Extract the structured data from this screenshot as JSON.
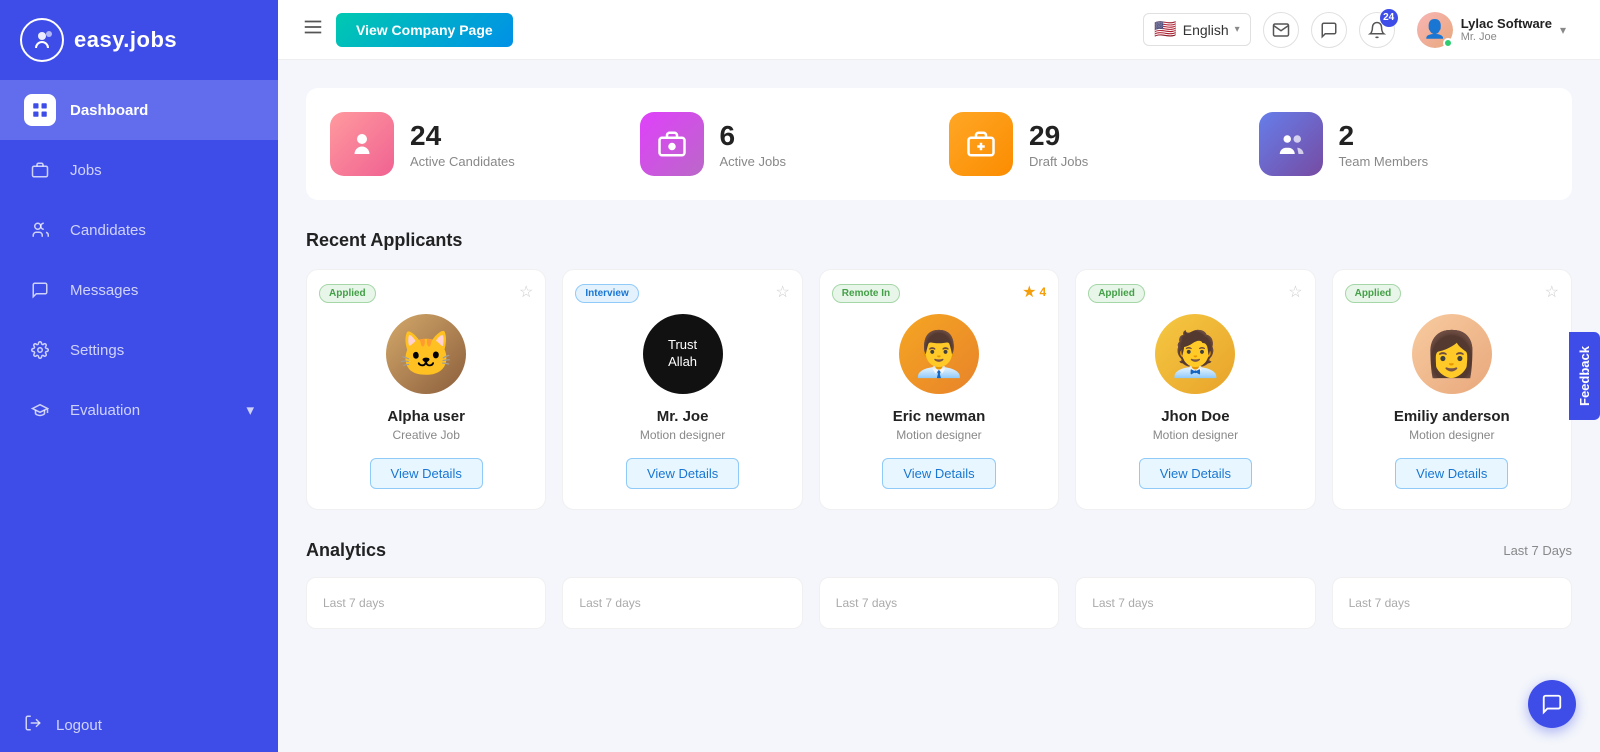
{
  "brand": {
    "logo_text": "easy.jobs",
    "logo_symbol": "i"
  },
  "sidebar": {
    "items": [
      {
        "id": "dashboard",
        "label": "Dashboard",
        "active": true
      },
      {
        "id": "jobs",
        "label": "Jobs",
        "active": false
      },
      {
        "id": "candidates",
        "label": "Candidates",
        "active": false
      },
      {
        "id": "messages",
        "label": "Messages",
        "active": false
      },
      {
        "id": "settings",
        "label": "Settings",
        "active": false
      },
      {
        "id": "evaluation",
        "label": "Evaluation",
        "active": false,
        "has_chevron": true
      }
    ],
    "logout_label": "Logout"
  },
  "header": {
    "view_company_btn": "View Company Page",
    "language": "English",
    "notification_count": "24",
    "user": {
      "company": "Lylac Software",
      "name": "Mr. Joe"
    }
  },
  "stats": [
    {
      "id": "active-candidates",
      "number": "24",
      "label": "Active Candidates",
      "icon_type": "person",
      "color": "pink"
    },
    {
      "id": "active-jobs",
      "number": "6",
      "label": "Active Jobs",
      "icon_type": "briefcase",
      "color": "magenta"
    },
    {
      "id": "draft-jobs",
      "number": "29",
      "label": "Draft Jobs",
      "icon_type": "briefcase",
      "color": "orange"
    },
    {
      "id": "team-members",
      "number": "2",
      "label": "Team Members",
      "icon_type": "group",
      "color": "blue-purple"
    }
  ],
  "recent_applicants": {
    "title": "Recent Applicants",
    "cards": [
      {
        "id": "alpha-user",
        "badge": "Applied",
        "badge_type": "applied",
        "name": "Alpha user",
        "role": "Creative Job",
        "has_star": true,
        "avatar_type": "cat",
        "view_label": "View Details"
      },
      {
        "id": "mr-joe",
        "badge": "Interview",
        "badge_type": "interview",
        "name": "Mr. Joe",
        "role": "Motion designer",
        "has_star": true,
        "avatar_type": "allah",
        "view_label": "View Details"
      },
      {
        "id": "eric-newman",
        "badge": "Remote In",
        "badge_type": "remote",
        "name": "Eric newman",
        "role": "Motion designer",
        "has_star": false,
        "star_count": "4",
        "avatar_type": "eric",
        "view_label": "View Details"
      },
      {
        "id": "jhon-doe",
        "badge": "Applied",
        "badge_type": "applied",
        "name": "Jhon Doe",
        "role": "Motion designer",
        "has_star": true,
        "avatar_type": "jhon",
        "view_label": "View Details"
      },
      {
        "id": "emiliy-anderson",
        "badge": "Applied",
        "badge_type": "applied",
        "name": "Emiliy anderson",
        "role": "Motion designer",
        "has_star": true,
        "avatar_type": "emily",
        "view_label": "View Details"
      }
    ]
  },
  "analytics": {
    "title": "Analytics",
    "period": "Last 7 Days",
    "chart_labels": [
      "Last 7 days",
      "Last 7 days",
      "Last 7 days",
      "Last 7 days",
      "Last 7 days"
    ]
  },
  "feedback_tab": "Feedback",
  "chat_icon": "💬"
}
